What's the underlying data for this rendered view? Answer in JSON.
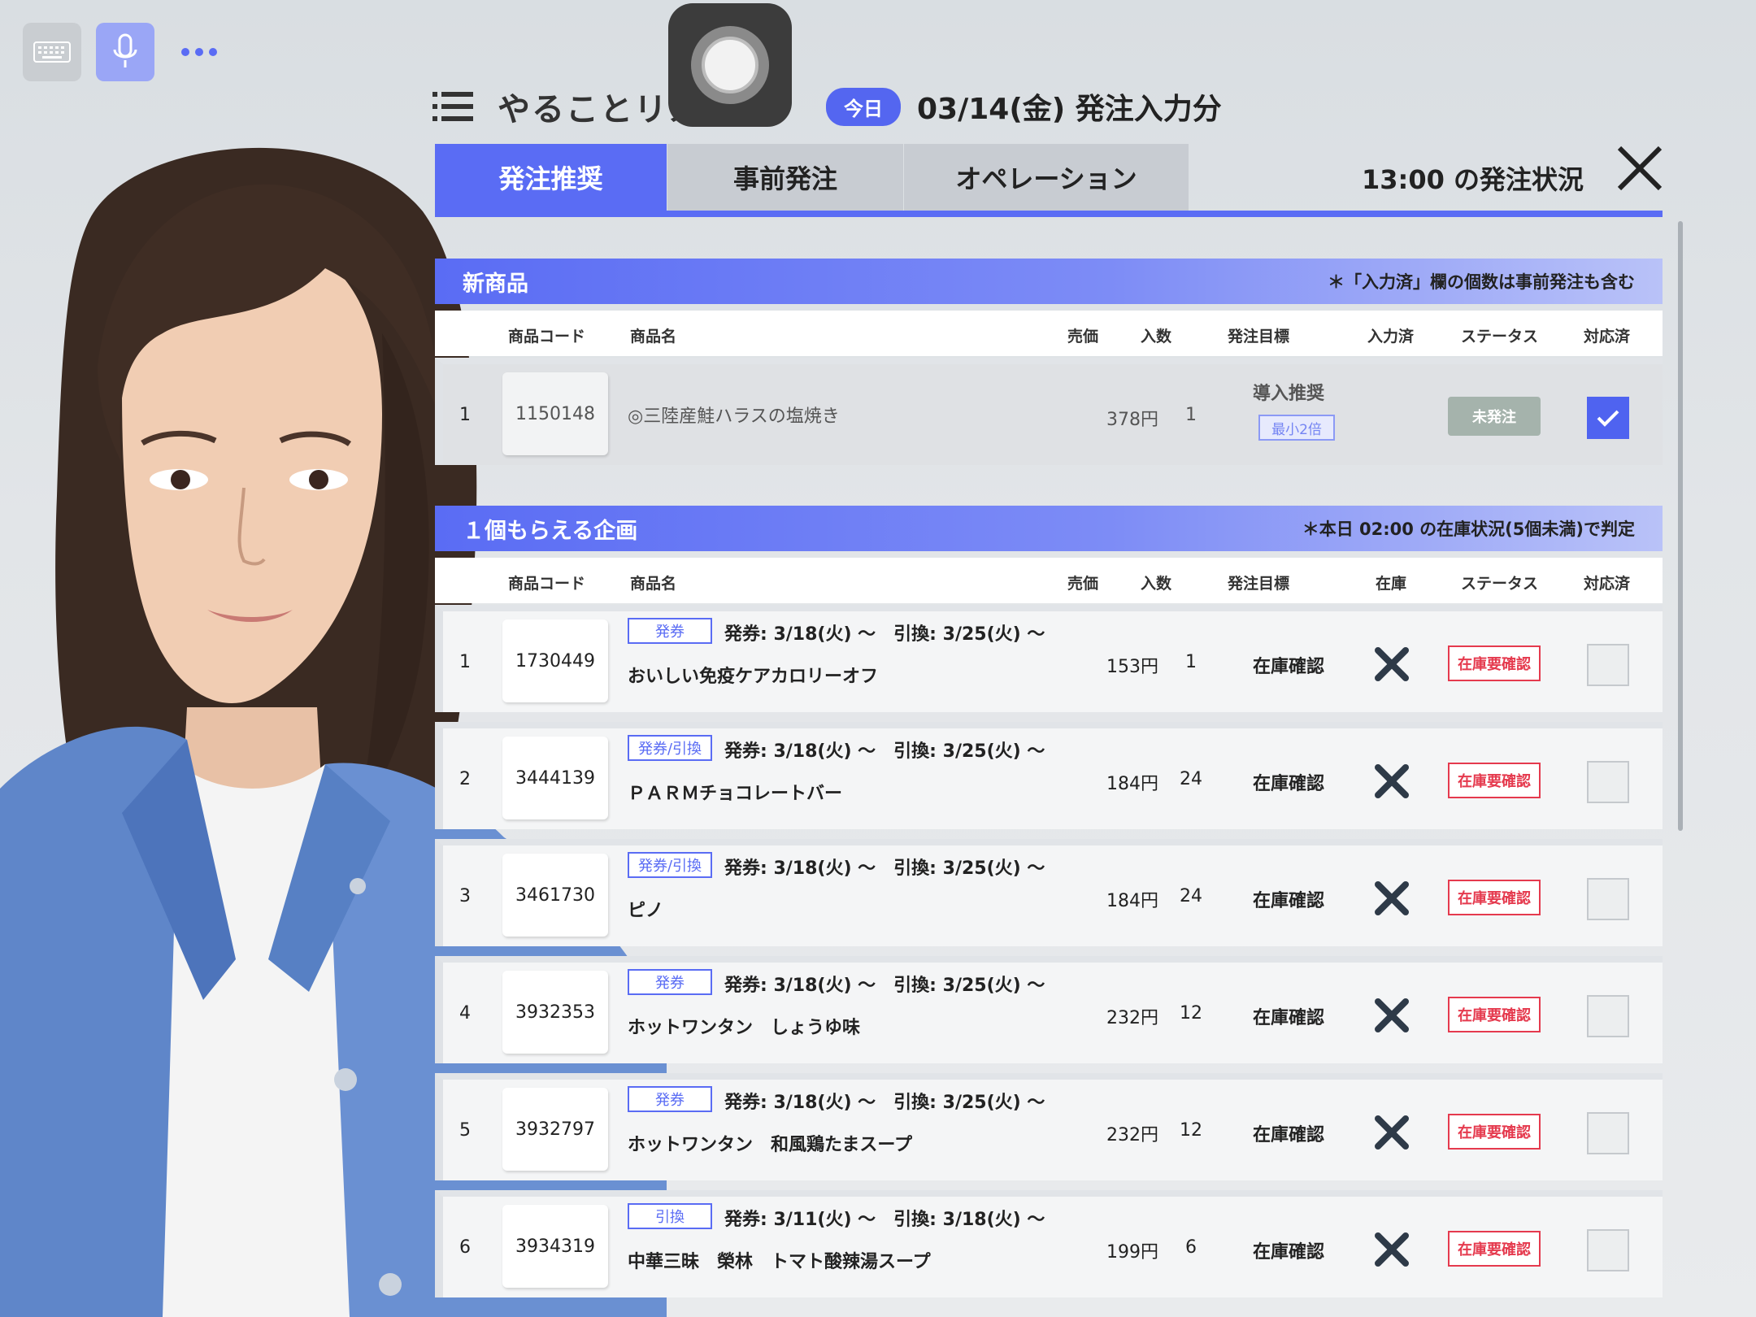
{
  "header": {
    "title": "やることリスト",
    "today_badge": "今日",
    "date": "03/14(金) 発注入力分"
  },
  "tabs": [
    {
      "label": "発注推奨",
      "active": true
    },
    {
      "label": "事前発注",
      "active": false
    },
    {
      "label": "オペレーション",
      "active": false
    }
  ],
  "status_time": "13:00 の発注状況",
  "colors": {
    "accent": "#5a6cf4",
    "alert": "#e53a4e"
  },
  "icons": [
    "keyboard-icon",
    "microphone-icon",
    "more-icon",
    "menu-icon",
    "close-icon",
    "cross-icon",
    "checkmark-icon"
  ],
  "new_products": {
    "title": "新商品",
    "note": "＊「入力済」欄の個数は事前発注も含む",
    "columns": [
      "商品コード",
      "商品名",
      "売価",
      "入数",
      "発注目標",
      "入力済",
      "ステータス",
      "対応済"
    ],
    "rows": [
      {
        "index": "1",
        "code": "1150148",
        "name": "◎三陸産鮭ハラスの塩焼き",
        "price": "378円",
        "qty": "1",
        "target": "導入推奨",
        "target_tag": "最小2倍",
        "status": "未発注",
        "done": true
      }
    ]
  },
  "campaign": {
    "title": "１個もらえる企画",
    "note": "＊本日 02:00 の在庫状況(5個未満)で判定",
    "columns": [
      "商品コード",
      "商品名",
      "売価",
      "入数",
      "発注目標",
      "在庫",
      "ステータス",
      "対応済"
    ],
    "rows": [
      {
        "index": "1",
        "code": "1730449",
        "tag": "発券",
        "dates": "発券: 3/18(火) ～　引換: 3/25(火) ～",
        "name": "おいしい免疫ケアカロリーオフ",
        "price": "153円",
        "qty": "1",
        "target": "在庫確認",
        "status": "在庫要確認",
        "done": false
      },
      {
        "index": "2",
        "code": "3444139",
        "tag": "発券/引換",
        "dates": "発券: 3/18(火) ～　引換: 3/25(火) ～",
        "name": "ＰＡＲＭチョコレートバー",
        "price": "184円",
        "qty": "24",
        "target": "在庫確認",
        "status": "在庫要確認",
        "done": false
      },
      {
        "index": "3",
        "code": "3461730",
        "tag": "発券/引換",
        "dates": "発券: 3/18(火) ～　引換: 3/25(火) ～",
        "name": "ピノ",
        "price": "184円",
        "qty": "24",
        "target": "在庫確認",
        "status": "在庫要確認",
        "done": false
      },
      {
        "index": "4",
        "code": "3932353",
        "tag": "発券",
        "dates": "発券: 3/18(火) ～　引換: 3/25(火) ～",
        "name": "ホットワンタン　しょうゆ味",
        "price": "232円",
        "qty": "12",
        "target": "在庫確認",
        "status": "在庫要確認",
        "done": false
      },
      {
        "index": "5",
        "code": "3932797",
        "tag": "発券",
        "dates": "発券: 3/18(火) ～　引換: 3/25(火) ～",
        "name": "ホットワンタン　和風鶏たまスープ",
        "price": "232円",
        "qty": "12",
        "target": "在庫確認",
        "status": "在庫要確認",
        "done": false
      },
      {
        "index": "6",
        "code": "3934319",
        "tag": "引換",
        "dates": "発券: 3/11(火) ～　引換: 3/18(火) ～",
        "name": "中華三昧　榮林　トマト酸辣湯スープ",
        "price": "199円",
        "qty": "6",
        "target": "在庫確認",
        "status": "在庫要確認",
        "done": false
      }
    ]
  }
}
